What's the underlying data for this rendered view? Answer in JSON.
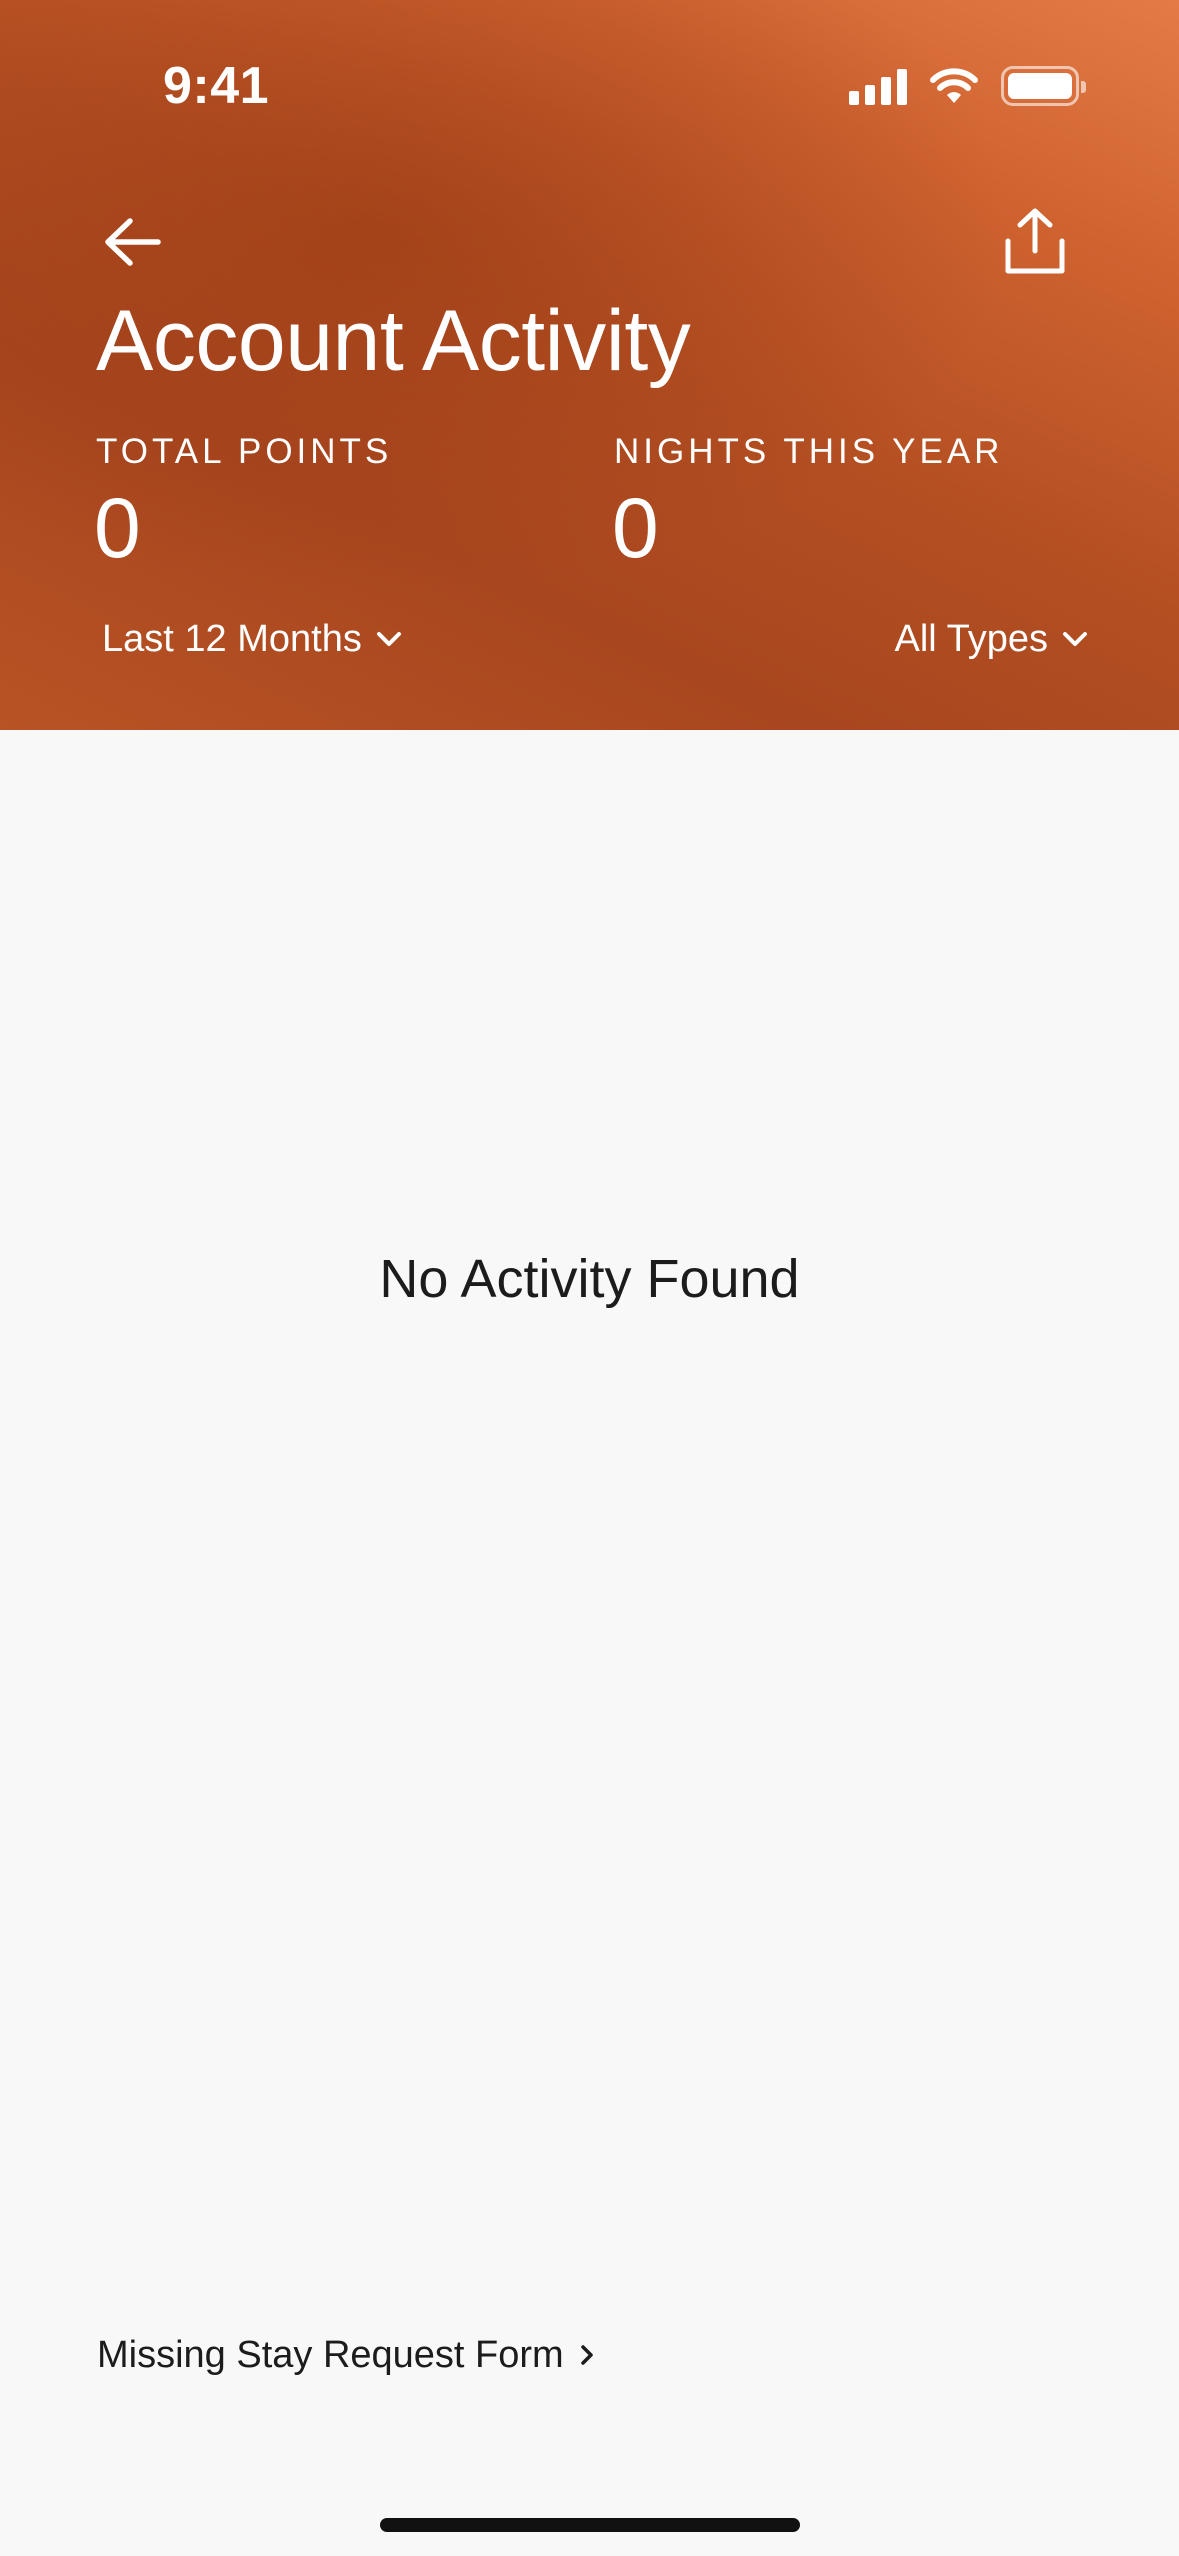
{
  "status_bar": {
    "time": "9:41",
    "icons": [
      "cellular-signal-icon",
      "wifi-icon",
      "battery-icon"
    ]
  },
  "header": {
    "title": "Account Activity",
    "back_icon": "arrow-left-icon",
    "share_icon": "share-icon",
    "gradient_colors": [
      "#e47b47",
      "#cf6330",
      "#a8461f"
    ],
    "stats": [
      {
        "label": "TOTAL POINTS",
        "value": "0"
      },
      {
        "label": "NIGHTS THIS YEAR",
        "value": "0"
      }
    ],
    "filters": {
      "period": {
        "selected": "Last 12 Months",
        "icon": "chevron-down-icon"
      },
      "type": {
        "selected": "All Types",
        "icon": "chevron-down-icon"
      }
    }
  },
  "main": {
    "empty_message": "No Activity Found",
    "missing_stay_link": {
      "label": "Missing Stay Request Form",
      "icon": "chevron-right-icon"
    }
  },
  "colors": {
    "header_text": "#ffffff",
    "body_background": "#f8f8f8",
    "body_text": "#1c1c1c"
  }
}
